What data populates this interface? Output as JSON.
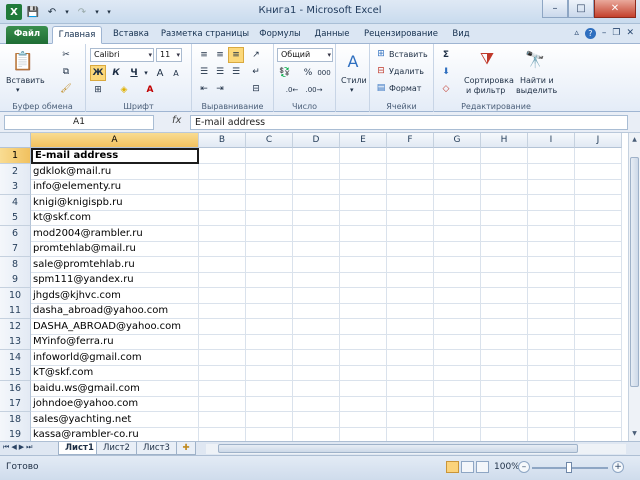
{
  "window": {
    "title": "Книга1 - Microsoft Excel"
  },
  "tabs": {
    "file": "Файл",
    "home": "Главная",
    "insert": "Вставка",
    "layout": "Разметка страницы",
    "formulas": "Формулы",
    "data": "Данные",
    "review": "Рецензирование",
    "view": "Вид"
  },
  "ribbon": {
    "clipboard": {
      "paste": "Вставить",
      "label": "Буфер обмена"
    },
    "font": {
      "name": "Calibri",
      "size": "11",
      "bold": "Ж",
      "italic": "К",
      "underline": "Ч",
      "grow": "A",
      "shrink": "A",
      "label": "Шрифт"
    },
    "alignment": {
      "label": "Выравнивание"
    },
    "number": {
      "format": "Общий",
      "percent": "%",
      "thousands": "000",
      "label": "Число"
    },
    "styles": {
      "label": "Стили"
    },
    "cells": {
      "insert": "Вставить",
      "delete": "Удалить",
      "format": "Формат",
      "label": "Ячейки"
    },
    "editing": {
      "sort_line1": "Сортировка",
      "sort_line2": "и фильтр",
      "find_line1": "Найти и",
      "find_line2": "выделить",
      "label": "Редактирование"
    }
  },
  "formula_bar": {
    "name_box": "A1",
    "fx": "fx",
    "content": "E-mail address"
  },
  "columns": [
    "A",
    "B",
    "C",
    "D",
    "E",
    "F",
    "G",
    "H",
    "I",
    "J"
  ],
  "rows": [
    {
      "n": "1",
      "a": "E-mail address"
    },
    {
      "n": "2",
      "a": "gdklok@mail.ru"
    },
    {
      "n": "3",
      "a": "info@elementy.ru"
    },
    {
      "n": "4",
      "a": "knigi@knigispb.ru"
    },
    {
      "n": "5",
      "a": "kt@skf.com"
    },
    {
      "n": "6",
      "a": "mod2004@rambler.ru"
    },
    {
      "n": "7",
      "a": "promtehlab@mail.ru"
    },
    {
      "n": "8",
      "a": "sale@promtehlab.ru"
    },
    {
      "n": "9",
      "a": "spm111@yandex.ru"
    },
    {
      "n": "10",
      "a": "jhgds@kjhvc.com"
    },
    {
      "n": "11",
      "a": "dasha_abroad@yahoo.com"
    },
    {
      "n": "12",
      "a": "DASHA_ABROAD@yahoo.com"
    },
    {
      "n": "13",
      "a": "MYinfo@ferra.ru"
    },
    {
      "n": "14",
      "a": "infoworld@gmail.com"
    },
    {
      "n": "15",
      "a": "kT@skf.com"
    },
    {
      "n": "16",
      "a": "baidu.ws@gmail.com"
    },
    {
      "n": "17",
      "a": "johndoe@yahoo.com"
    },
    {
      "n": "18",
      "a": "sales@yachting.net"
    },
    {
      "n": "19",
      "a": "kassa@rambler-co.ru"
    }
  ],
  "sheets": [
    "Лист1",
    "Лист2",
    "Лист3"
  ],
  "status": {
    "text": "Готово",
    "zoom": "100%"
  }
}
